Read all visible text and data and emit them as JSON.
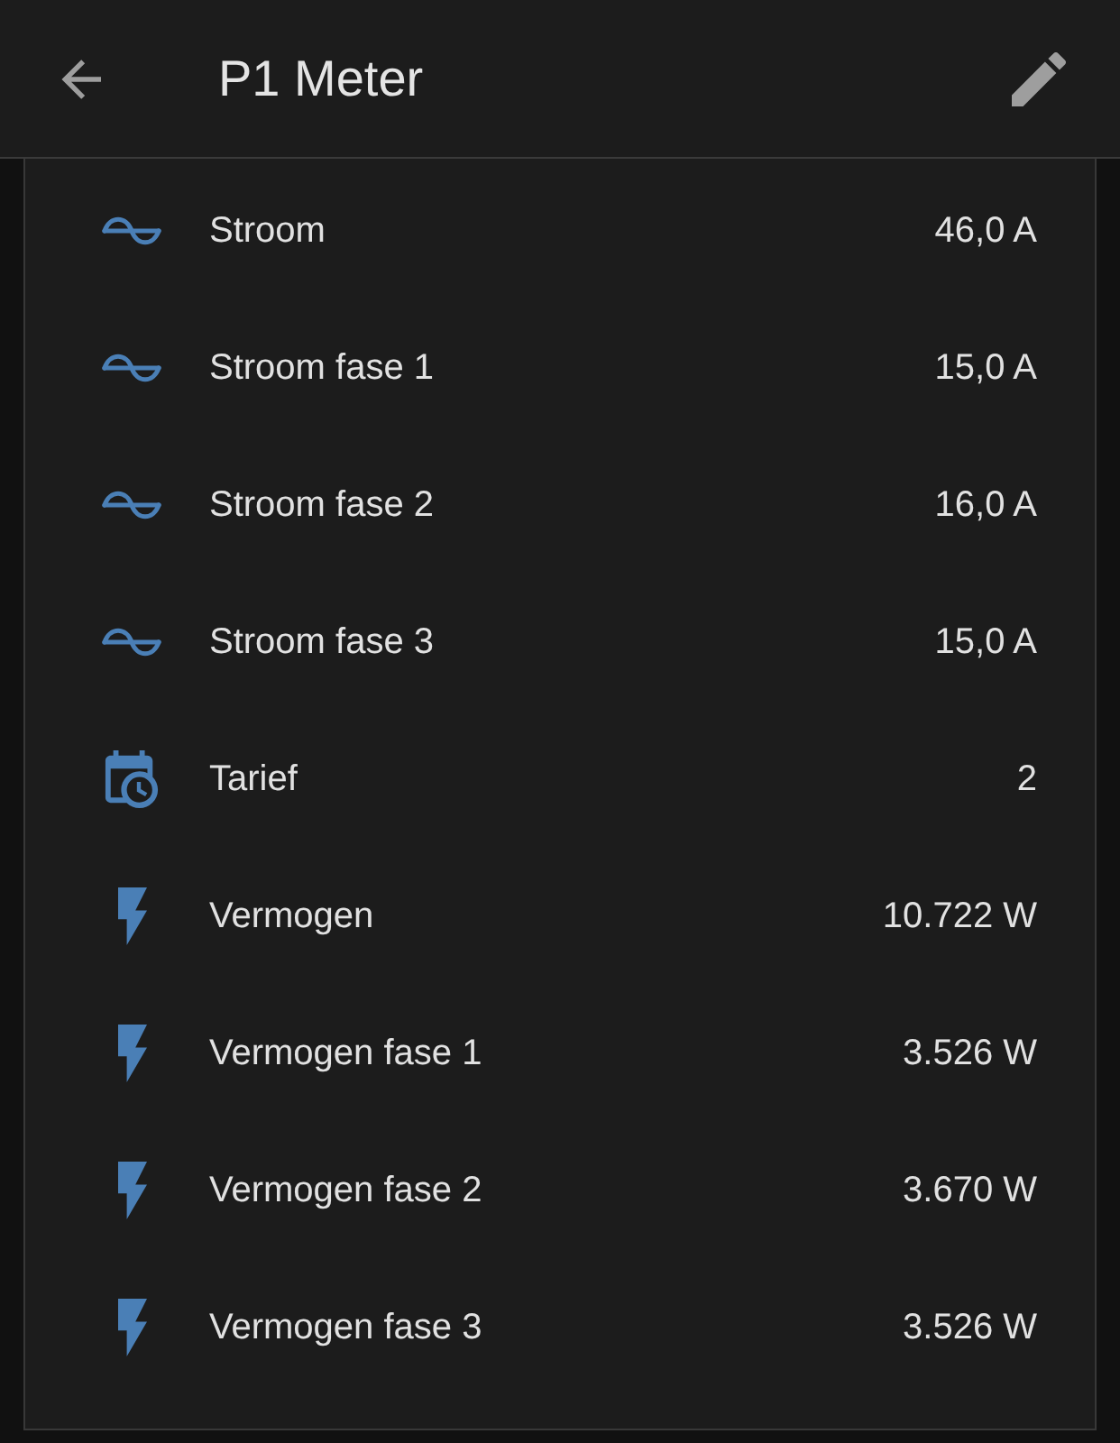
{
  "header": {
    "title": "P1 Meter"
  },
  "entities": [
    {
      "kind": "current",
      "name": "Stroom",
      "value": "46,0 A"
    },
    {
      "kind": "current",
      "name": "Stroom fase 1",
      "value": "15,0 A"
    },
    {
      "kind": "current",
      "name": "Stroom fase 2",
      "value": "16,0 A"
    },
    {
      "kind": "current",
      "name": "Stroom fase 3",
      "value": "15,0 A"
    },
    {
      "kind": "tariff",
      "name": "Tarief",
      "value": "2"
    },
    {
      "kind": "power",
      "name": "Vermogen",
      "value": "10.722 W"
    },
    {
      "kind": "power",
      "name": "Vermogen fase 1",
      "value": "3.526 W"
    },
    {
      "kind": "power",
      "name": "Vermogen fase 2",
      "value": "3.670 W"
    },
    {
      "kind": "power",
      "name": "Vermogen fase 3",
      "value": "3.526 W"
    }
  ]
}
